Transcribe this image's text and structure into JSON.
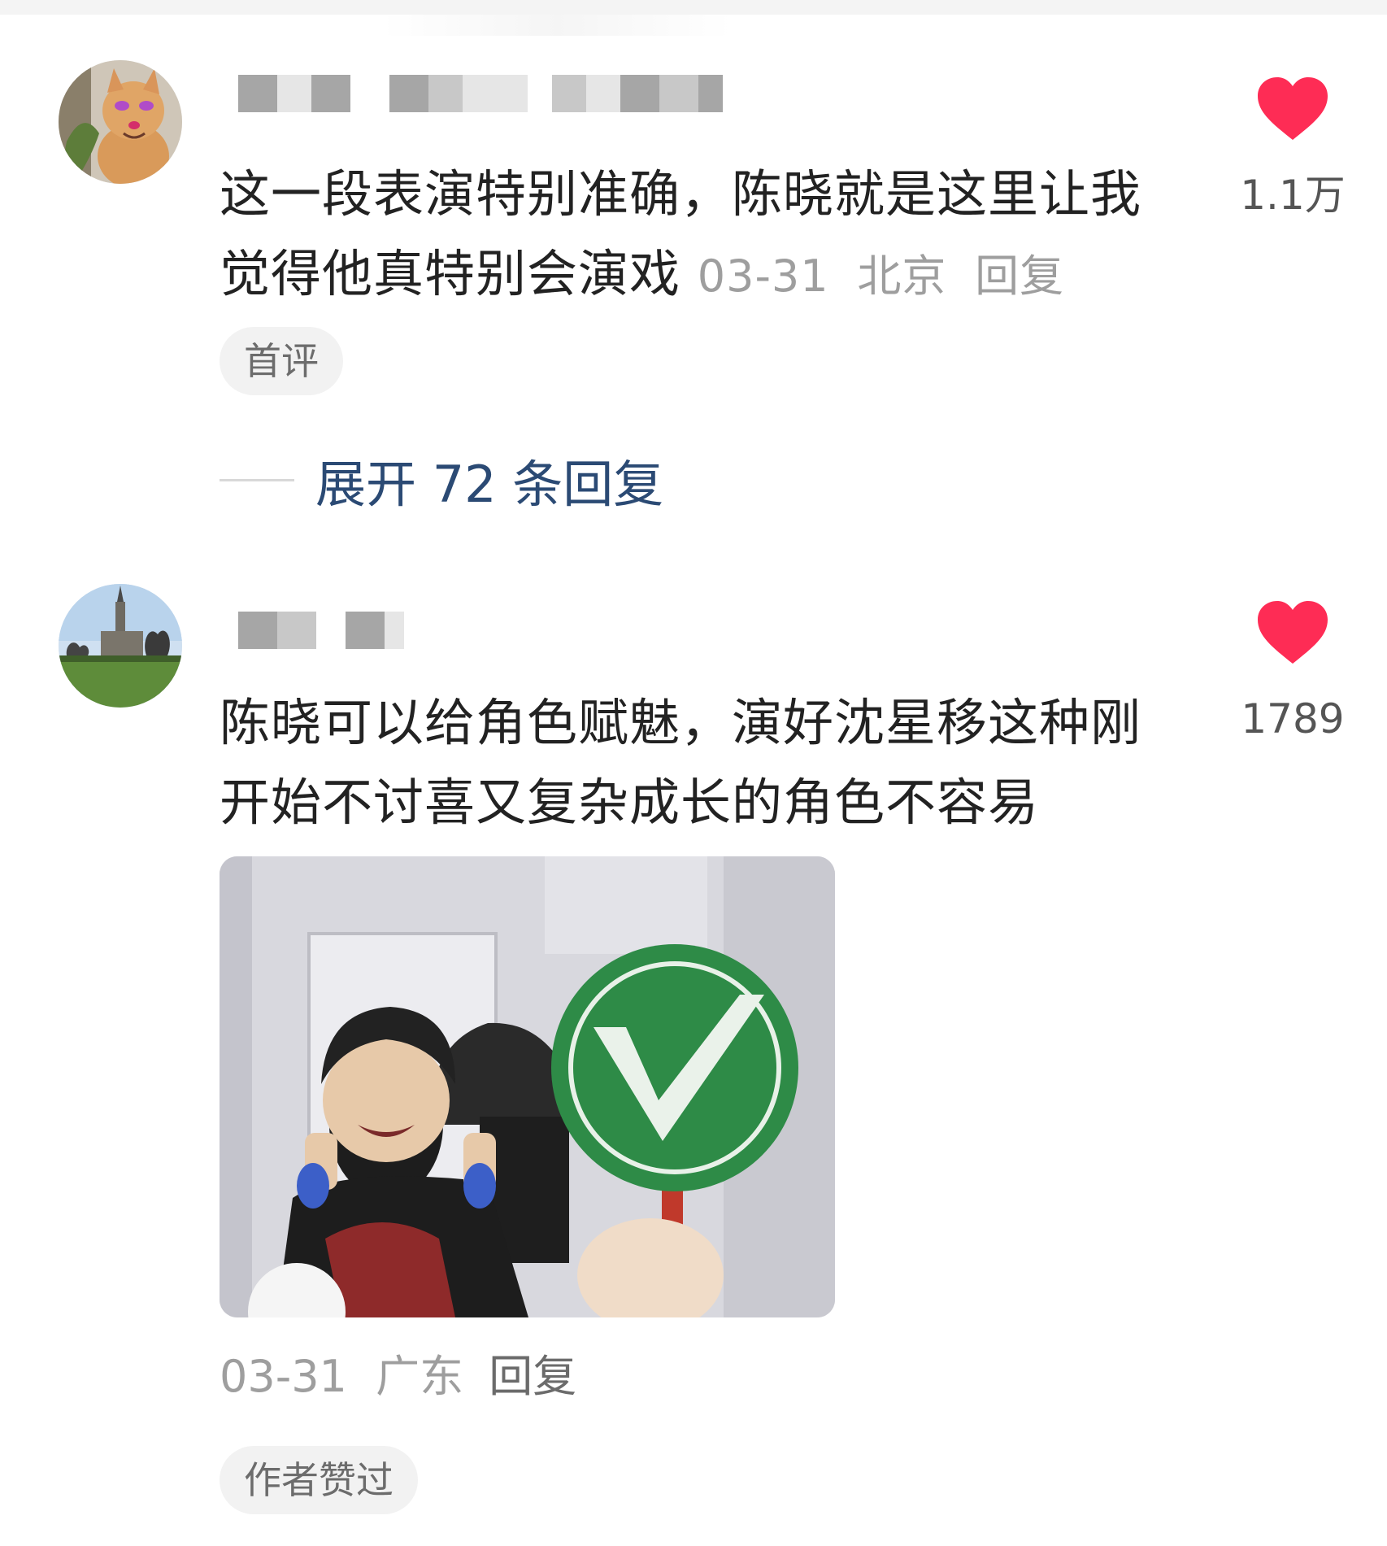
{
  "comments": [
    {
      "text": "这一段表演特别准确，陈晓就是这里让我觉得他真特别会演戏",
      "date": "03-31",
      "location": "北京",
      "reply_label": "回复",
      "badge": "首评",
      "likes": "1.1万",
      "expand_label": "展开 72 条回复"
    },
    {
      "text": "陈晓可以给角色赋魅，演好沈星移这种刚开始不讨喜又复杂成长的角色不容易",
      "date": "03-31",
      "location": "广东",
      "reply_label": "回复",
      "badge": "作者赞过",
      "likes": "1789"
    }
  ],
  "icons": {
    "like": "heart-icon"
  },
  "colors": {
    "like": "#fe2c55",
    "expand": "#2b4a74"
  }
}
